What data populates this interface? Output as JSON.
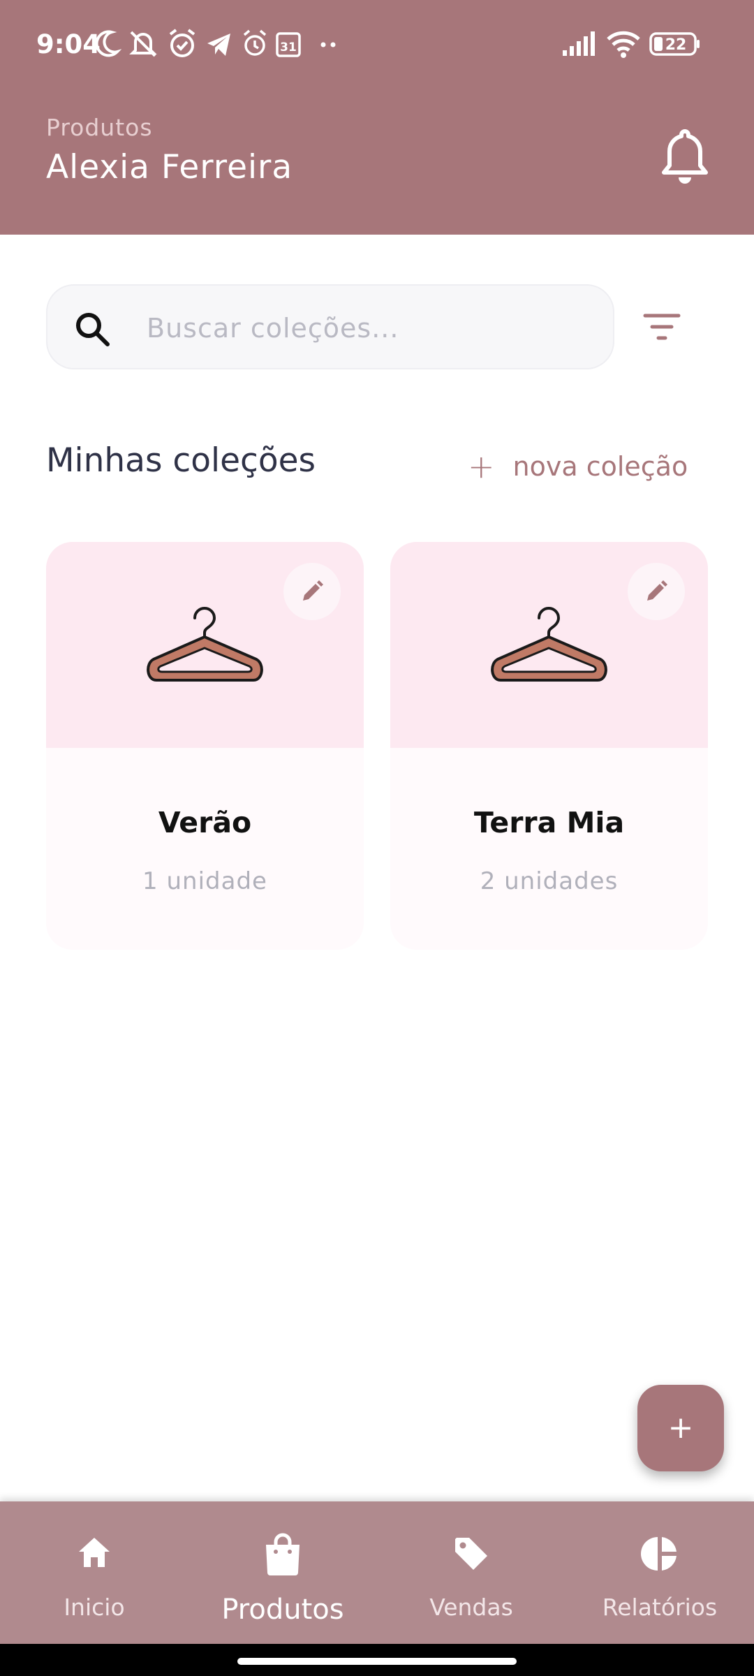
{
  "status_bar": {
    "time": "9:04",
    "battery": "22",
    "icons_left": [
      "moon-icon",
      "mute-icon",
      "alarm-icon",
      "telegram-icon",
      "alarm-icon",
      "calendar-icon",
      "more-dots-icon"
    ],
    "icons_right": [
      "signal-icon",
      "wifi-icon",
      "battery-icon"
    ]
  },
  "header": {
    "subtitle": "Produtos",
    "title": "Alexia Ferreira",
    "background_color": "#a7767a"
  },
  "search": {
    "placeholder": "Buscar coleções...",
    "value": ""
  },
  "section": {
    "title": "Minhas coleções",
    "action_label": "nova coleção"
  },
  "collections": [
    {
      "name": "Verão",
      "count": "1 unidade"
    },
    {
      "name": "Terra Mia",
      "count": "2 unidades"
    }
  ],
  "fab": {
    "label": "+"
  },
  "bottom_nav": {
    "items": [
      {
        "label": "Inicio",
        "icon": "home-icon",
        "active": false
      },
      {
        "label": "Produtos",
        "icon": "shopping-bag-icon",
        "active": true
      },
      {
        "label": "Vendas",
        "icon": "tag-icon",
        "active": false
      },
      {
        "label": "Relatórios",
        "icon": "pie-chart-icon",
        "active": false
      }
    ]
  },
  "colors": {
    "accent": "#a7767a",
    "card_top": "#fde9f1",
    "nav_background": "#b08a8e"
  }
}
